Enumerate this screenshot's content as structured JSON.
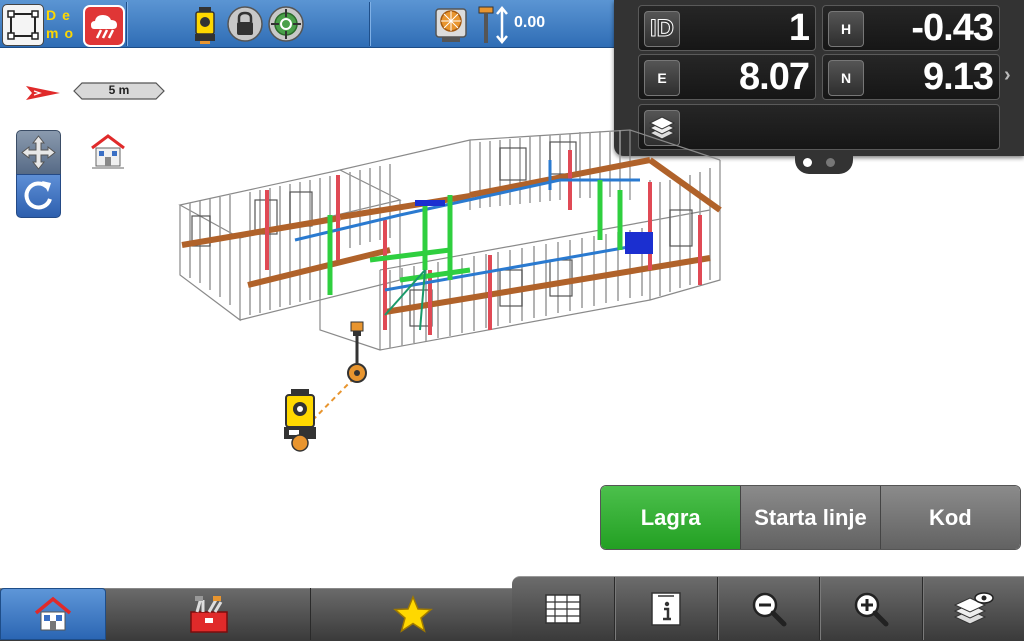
{
  "top_bar": {
    "demo_label": "De mo",
    "height_value": "0.00"
  },
  "coordinates": {
    "id": {
      "label": "ID",
      "value": "1"
    },
    "h": {
      "label": "H",
      "value": "-0.43"
    },
    "e": {
      "label": "E",
      "value": "8.07"
    },
    "n": {
      "label": "N",
      "value": "9.13"
    },
    "layer_value": "",
    "page_count": 2,
    "active_page": 1
  },
  "map": {
    "scale_label": "5 m"
  },
  "actions": {
    "primary": "Lagra",
    "secondary": "Starta linje",
    "tertiary": "Kod"
  },
  "colors": {
    "accent_blue": "#2f6db5",
    "action_green": "#2ea82e",
    "panel_dark": "#333333",
    "warning_yellow": "#ffd800"
  },
  "icons": {
    "bottom_left": [
      "home-icon",
      "toolbox-icon",
      "star-icon"
    ],
    "bottom_right": [
      "table-icon",
      "info-icon",
      "zoom-out-icon",
      "zoom-in-icon",
      "layers-visibility-icon"
    ]
  }
}
